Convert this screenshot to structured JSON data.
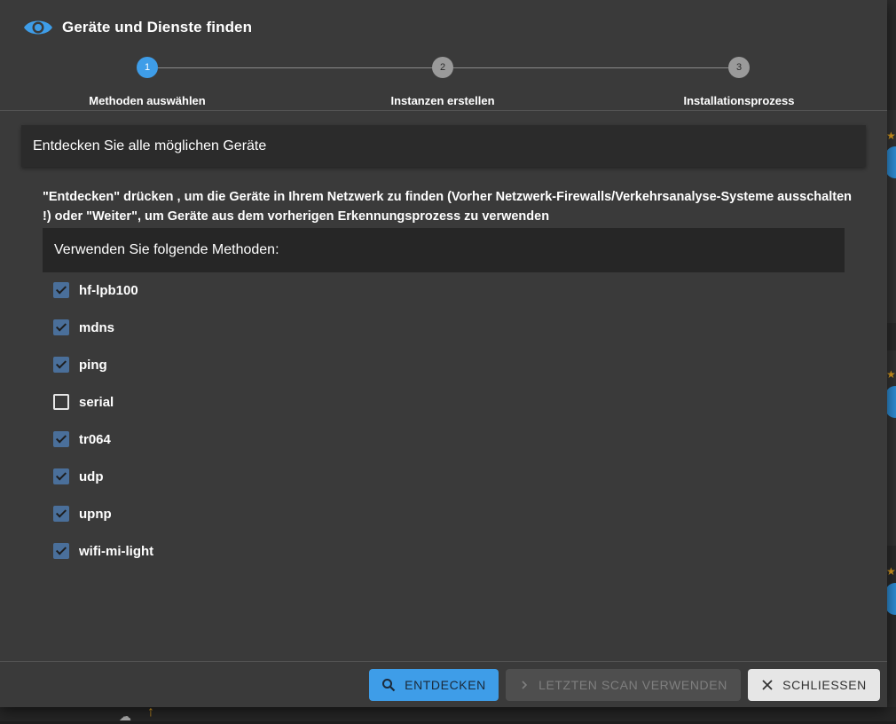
{
  "dialog": {
    "title": "Geräte und Dienste finden",
    "icon": "eye-icon",
    "accent_color": "#3e9de8"
  },
  "stepper": {
    "steps": [
      {
        "number": "1",
        "label": "Methoden auswählen",
        "active": true
      },
      {
        "number": "2",
        "label": "Instanzen erstellen",
        "active": false
      },
      {
        "number": "3",
        "label": "Installationsprozess",
        "active": false
      }
    ]
  },
  "section": {
    "heading": "Entdecken Sie alle möglichen Geräte",
    "hint": "\"Entdecken\" drücken , um die Geräte in Ihrem Netzwerk zu finden (Vorher Netzwerk-Firewalls/Verkehrsanalyse-Systeme ausschalten !) oder \"Weiter\", um Geräte aus dem vorherigen Erkennungsprozess zu verwenden",
    "methods_heading": "Verwenden Sie folgende Methoden:"
  },
  "methods": [
    {
      "label": "hf-lpb100",
      "checked": true
    },
    {
      "label": "mdns",
      "checked": true
    },
    {
      "label": "ping",
      "checked": true
    },
    {
      "label": "serial",
      "checked": false
    },
    {
      "label": "tr064",
      "checked": true
    },
    {
      "label": "udp",
      "checked": true
    },
    {
      "label": "upnp",
      "checked": true
    },
    {
      "label": "wifi-mi-light",
      "checked": true
    }
  ],
  "buttons": {
    "discover": {
      "label": "ENTDECKEN",
      "icon": "search-icon"
    },
    "use_last": {
      "label": "LETZTEN SCAN VERWENDEN",
      "icon": "chevron-right-icon",
      "disabled": true
    },
    "close": {
      "label": "SCHLIESSEN",
      "icon": "close-icon"
    }
  }
}
